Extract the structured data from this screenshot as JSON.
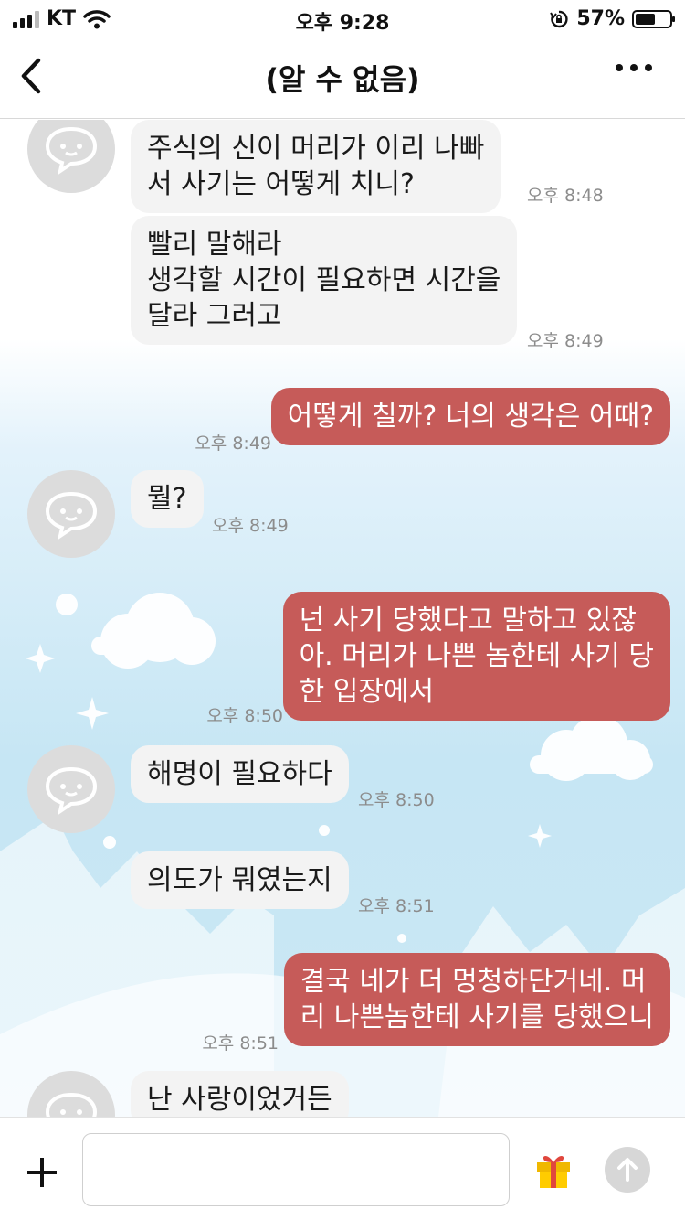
{
  "status_bar": {
    "carrier": "KT",
    "time": "오후 9:28",
    "battery": "57%",
    "battery_level": 0.57
  },
  "nav": {
    "title": "(알 수 없음)",
    "back_icon": "chevron-left-icon",
    "more_icon": "ellipsis-icon"
  },
  "messages": [
    {
      "side": "in",
      "lines": [
        "주식의 신이 머리가 이리 나빠",
        "서 사기는 어떻게 치니?"
      ],
      "time": "오후 8:48"
    },
    {
      "side": "in",
      "lines": [
        "빨리 말해라",
        "생각할 시간이 필요하면 시간을",
        "달라 그러고"
      ],
      "time": "오후 8:49"
    },
    {
      "side": "out",
      "lines": [
        "어떻게 칠까? 너의 생각은 어때?"
      ],
      "time": "오후 8:49"
    },
    {
      "side": "in",
      "lines": [
        "뭘?"
      ],
      "time": "오후 8:49"
    },
    {
      "side": "out",
      "lines": [
        "넌 사기 당했다고 말하고 있잖",
        "아. 머리가 나쁜 놈한테 사기 당",
        "한 입장에서"
      ],
      "time": "오후 8:50"
    },
    {
      "side": "in",
      "lines": [
        "해명이 필요하다"
      ],
      "time": "오후 8:50"
    },
    {
      "side": "in",
      "lines": [
        "의도가 뭐였는지"
      ],
      "time": "오후 8:51"
    },
    {
      "side": "out",
      "lines": [
        "결국 네가 더 멍청하단거네. 머",
        "리 나쁜놈한테 사기를 당했으니"
      ],
      "time": "오후 8:51"
    },
    {
      "side": "in",
      "lines": [
        "난 사랑이었거든"
      ],
      "time": ""
    }
  ],
  "input": {
    "placeholder": "",
    "plus_icon": "plus-icon",
    "gift_icon": "gift-icon",
    "send_icon": "send-arrow-icon"
  },
  "colors": {
    "outgoing_bubble": "#c65b59",
    "incoming_bubble": "#f3f3f3",
    "sky": "#c6e6f4"
  }
}
